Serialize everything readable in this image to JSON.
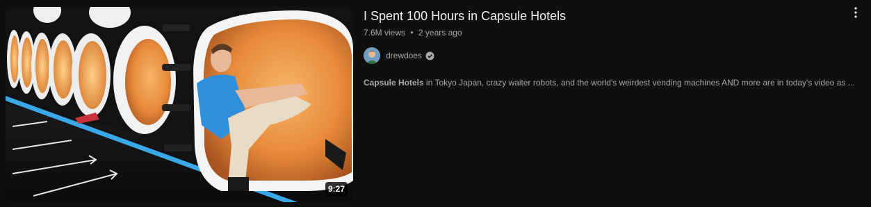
{
  "video": {
    "title": "I Spent 100 Hours in Capsule Hotels",
    "views": "7.6M views",
    "separator": "•",
    "age": "2 years ago",
    "duration": "9:27",
    "channel": {
      "name": "drewdoes",
      "verified": true,
      "avatar_icon": "avatar"
    },
    "description": {
      "highlight": "Capsule Hotels",
      "rest": " in Tokyo Japan, crazy waiter robots, and the world's weirdest vending machines AND more are in today's video as ..."
    },
    "menu_icon": "more-vert-icon"
  },
  "colors": {
    "background": "#0f0f0f",
    "title": "#f1f1f1",
    "secondary": "#aaaaaa",
    "capsule_glow": "#f0a250",
    "shirt": "#2f8fd8"
  }
}
